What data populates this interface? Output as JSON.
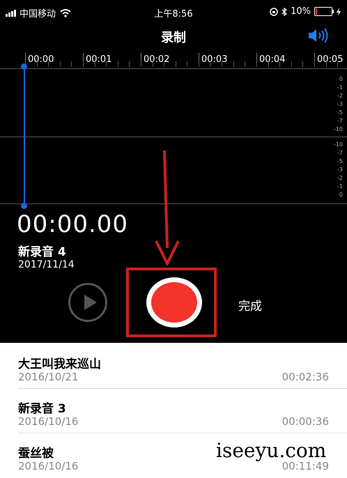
{
  "status": {
    "carrier": "中国移动",
    "time": "上午8:56",
    "battery": "10%"
  },
  "title": "录制",
  "timeline": {
    "labels": [
      "00:00",
      "00:01",
      "00:02",
      "00:03",
      "00:04",
      "00:05"
    ]
  },
  "db_top": [
    "0",
    "-1",
    "-2",
    "-3",
    "-5",
    "-7",
    "-10"
  ],
  "db_bottom": [
    "-10",
    "-7",
    "-5",
    "-3",
    "-2",
    "-1",
    "0"
  ],
  "recording": {
    "elapsed": "00:00.00",
    "name": "新录音 4",
    "date": "2017/11/14"
  },
  "controls": {
    "done_label": "完成"
  },
  "recordings": [
    {
      "name": "大王叫我来巡山",
      "date": "2016/10/21",
      "duration": "00:02:36"
    },
    {
      "name": "新录音 3",
      "date": "2016/10/16",
      "duration": "00:00:36"
    },
    {
      "name": "蚕丝被",
      "date": "2016/10/16",
      "duration": "00:11:49"
    }
  ],
  "watermark": "iseeyu.com",
  "colors": {
    "record_red": "#f2342a",
    "annotation_red": "#c9211e",
    "playhead_blue": "#1e64d8"
  }
}
